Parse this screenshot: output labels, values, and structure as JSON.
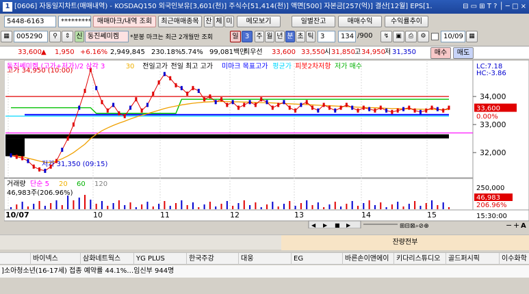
{
  "title": {
    "num": "1",
    "text": "[0606] 자동일지차트(매매내역) - KOSDAQ150 외국인보유[3,601(천)] 주식수[51,414(천)] 액면[500] 자본금[257(억)] 결산[12월] EPS[1.",
    "controls": "⊟ ▭ ⊞ T ? │ ─ □ ×"
  },
  "toolbar1": {
    "account": "5448-6163",
    "password": "*********",
    "btn_trade_mark": "매매마크/내역 조회",
    "btn_recent": "최근매매종목",
    "btn_jan": "잔",
    "btn_che": "체",
    "btn_mi": "미",
    "btn_memo": "메모보기",
    "btn_daily_balance": "일별잔고",
    "btn_trade_return": "매매수익",
    "btn_return_trend": "수익률추이"
  },
  "toolbar2": {
    "code": "005290",
    "credit": "신",
    "stock_name": "동진쎄미켐",
    "note": "*분봉 마크는 최근 2개월만 조회",
    "day": "일",
    "count_sel": "3",
    "week": "주",
    "month": "월",
    "year": "년",
    "minute": "분",
    "sec": "초",
    "tick": "틱",
    "tick_sel": "3",
    "page": "134",
    "page_total": "/900",
    "date": "10/09"
  },
  "pricebar": {
    "price": "33,600",
    "arrow": "▲",
    "change": "1,950",
    "pct": "+6.16%",
    "volume": "2,949,845",
    "vol_pct": "230.18%",
    "turnover": "5.74%",
    "amount": "99,081백만",
    "best_sell_label": "최우선",
    "best_sell": "33,600",
    "best_buy": "33,550",
    "open_label": "시",
    "open": "31,850",
    "high_label": "고",
    "high": "34,950",
    "low_label": "저",
    "low": "31,350",
    "buy": "매수",
    "sell": "매도"
  },
  "chart_data": {
    "type": "line",
    "legend_price": [
      "동진쎄미켐",
      "(고가+저가)/2 삼각 3",
      "30",
      "전일고가",
      "전일 최고 고가",
      "미마크 목표고가",
      "평균가",
      "피봇2차저항",
      "저가 매수"
    ],
    "legend_colors": [
      "#ff00ff",
      "#ff00ff",
      "#f0b000",
      "#000000",
      "#000000",
      "#0000ff",
      "#00d8ff",
      "#ff0000",
      "#00b000"
    ],
    "lc_label": "LC:7.18",
    "hc_label": "HC:-3.86",
    "high_marker": "고가 34,950 (10:00)",
    "low_marker": "저가 31,350 (09:15)",
    "price_axis": [
      "34,000",
      "33,000",
      "32,000"
    ],
    "price_axis_values": [
      34000,
      33000,
      32000
    ],
    "ylim": [
      31200,
      35100
    ],
    "current_price": "33,600",
    "current_pct": "0.00%",
    "x_ticks": [
      "10/07",
      "10",
      "11",
      "12",
      "13",
      "14",
      "15"
    ],
    "x_time": "15:30:00",
    "price_series": [
      31900,
      31850,
      31800,
      31700,
      31500,
      31400,
      31350,
      31500,
      31700,
      32100,
      32500,
      33000,
      33600,
      34200,
      34950,
      34300,
      33800,
      33500,
      33700,
      33400,
      33300,
      33600,
      33900,
      33500,
      33700,
      34100,
      34500,
      34800,
      34650,
      34400,
      34300,
      34100,
      34300,
      34200,
      33900,
      34000,
      33800,
      33900,
      33700,
      33800,
      33600,
      33700,
      33800,
      33700,
      33900,
      33800,
      33600,
      33700,
      33800,
      33600,
      33500,
      33700,
      33800,
      33600,
      33500,
      33700,
      33600,
      33500,
      33600,
      33700,
      33600,
      33500,
      33600,
      33550,
      33500,
      33600,
      33500,
      33450,
      33500,
      33550,
      33600,
      33500,
      33450,
      33500,
      33600,
      33550,
      33500,
      33600
    ],
    "ma30_series": [
      31900,
      31880,
      31850,
      31800,
      31750,
      31700,
      31650,
      31650,
      31700,
      31780,
      31880,
      32000,
      32150,
      32300,
      32500,
      32650,
      32780,
      32880,
      32970,
      33050,
      33120,
      33200,
      33270,
      33330,
      33390,
      33450,
      33510,
      33570,
      33620,
      33660,
      33700,
      33730,
      33760,
      33780,
      33800,
      33810,
      33820,
      33820,
      33820,
      33810,
      33810,
      33800,
      33800,
      33790,
      33780,
      33780,
      33770,
      33760,
      33750,
      33740,
      33730,
      33720,
      33710,
      33700,
      33690,
      33680,
      33670,
      33660,
      33650,
      33640,
      33630,
      33620,
      33610,
      33600,
      33600,
      33590,
      33580,
      33570,
      33570,
      33560,
      33560,
      33550,
      33550,
      33540,
      33540,
      33530,
      33530,
      33530
    ],
    "prev_high": 33900,
    "resist2": 34000,
    "target_high": 33350,
    "avg_price": 33300,
    "low_buy": 32700,
    "volume_legend": [
      "거래량",
      "단순 5",
      "20",
      "60",
      "120"
    ],
    "volume_legend_colors": [
      "#000000",
      "#ff00ff",
      "#f0b000",
      "#00b000",
      "#808080"
    ],
    "volume_text": "46,983주(206.96%)",
    "volume_axis": "250,000",
    "volume_current": "46,983",
    "volume_current_pct": "206.96%"
  },
  "bottom": {
    "section": "잔량전부"
  },
  "stocks": [
    "바이넥스",
    "삼화네트웍스",
    "YG PLUS",
    "한국주강",
    "대웅",
    "EG",
    "바른손이앤에이",
    "키다리스튜디오",
    "골드퍼시픽",
    "이수화학"
  ],
  "news": "]소아청소년(16-17세) 접종 예약률 44.1%…임신부 944명"
}
